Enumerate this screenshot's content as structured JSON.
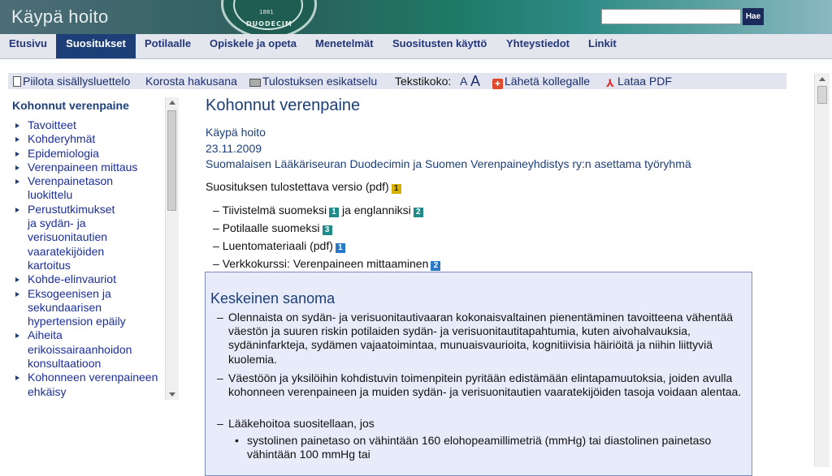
{
  "header": {
    "logo_text": "Käypä hoito",
    "seal_number": "1881",
    "seal_word": "DUODECIM",
    "search_placeholder": "",
    "search_button": "Hae"
  },
  "nav": {
    "items": [
      "Etusivu",
      "Suositukset",
      "Potilaalle",
      "Opiskele ja opeta",
      "Menetelmät",
      "Suositusten käyttö",
      "Yhteystiedot",
      "Linkit"
    ],
    "active_index": 1
  },
  "toolbar": {
    "hide_toc": "Piilota sisällysluettelo",
    "highlight": "Korosta hakusana",
    "print_preview": "Tulostuksen esikatselu",
    "text_size_label": "Tekstikoko:",
    "text_small": "A",
    "text_large": "A",
    "send": "Lähetä kollegalle",
    "download": "Lataa PDF"
  },
  "sidebar": {
    "title": "Kohonnut verenpaine",
    "items": [
      "Tavoitteet",
      "Kohderyhmät",
      "Epidemiologia",
      "Verenpaineen mittaus",
      "Verenpainetason luokittelu",
      "Perustutkimukset ja sydän- ja verisuonitautien vaaratekijöiden kartoitus",
      "Kohde-elinvauriot",
      "Eksogeenisen ja sekundaarisen hypertension epäily",
      "Aiheita erikoissairaanhoidon konsultaatioon",
      "Kohonneen verenpaineen ehkäisy"
    ]
  },
  "main": {
    "title": "Kohonnut verenpaine",
    "source": "Käypä hoito",
    "date": "23.11.2009",
    "authors": "Suomalaisen Lääkäriseuran Duodecimin ja Suomen Verenpaineyhdistys ry:n asettama työryhmä",
    "printable": "Suosituksen tulostettava versio (pdf)",
    "printable_badge": "1",
    "links": {
      "summary_fi": "Tiivistelmä suomeksi",
      "summary_fi_badge": "1",
      "summary_and": "ja englanniksi",
      "summary_en_badge": "2",
      "patient": "Potilaalle suomeksi",
      "patient_badge": "3",
      "lecture": "Luentomateriaali (pdf)",
      "lecture_badge": "1",
      "course": "Verkkokurssi: Verenpaineen mittaaminen",
      "course_badge": "2"
    },
    "key_message": {
      "title": "Keskeinen sanoma",
      "bullets": [
        "Olennaista on sydän- ja verisuonitautivaaran kokonaisvaltainen pienentäminen tavoitteena vähentää väestön ja suuren riskin potilaiden sydän- ja verisuonitautitapahtumia, kuten aivohalvauksia, sydäninfarkteja, sydämen vajaatoimintaa, munuaisvaurioita, kognitiivisia häiriöitä ja niihin liittyviä kuolemia.",
        "Väestöön ja yksilöihin kohdistuvin toimenpitein pyritään edistämään elintapamuutoksia, joiden avulla kohonneen verenpaineen ja muiden sydän- ja verisuonitautien vaaratekijöiden tasoja voidaan alentaa.",
        "Lääkehoitoa suositellaan, jos"
      ],
      "sub_bullet": "systolinen painetaso on vähintään 160 elohopeamillimetriä (mmHg) tai diastolinen painetaso vähintään 100 mmHg tai"
    }
  }
}
